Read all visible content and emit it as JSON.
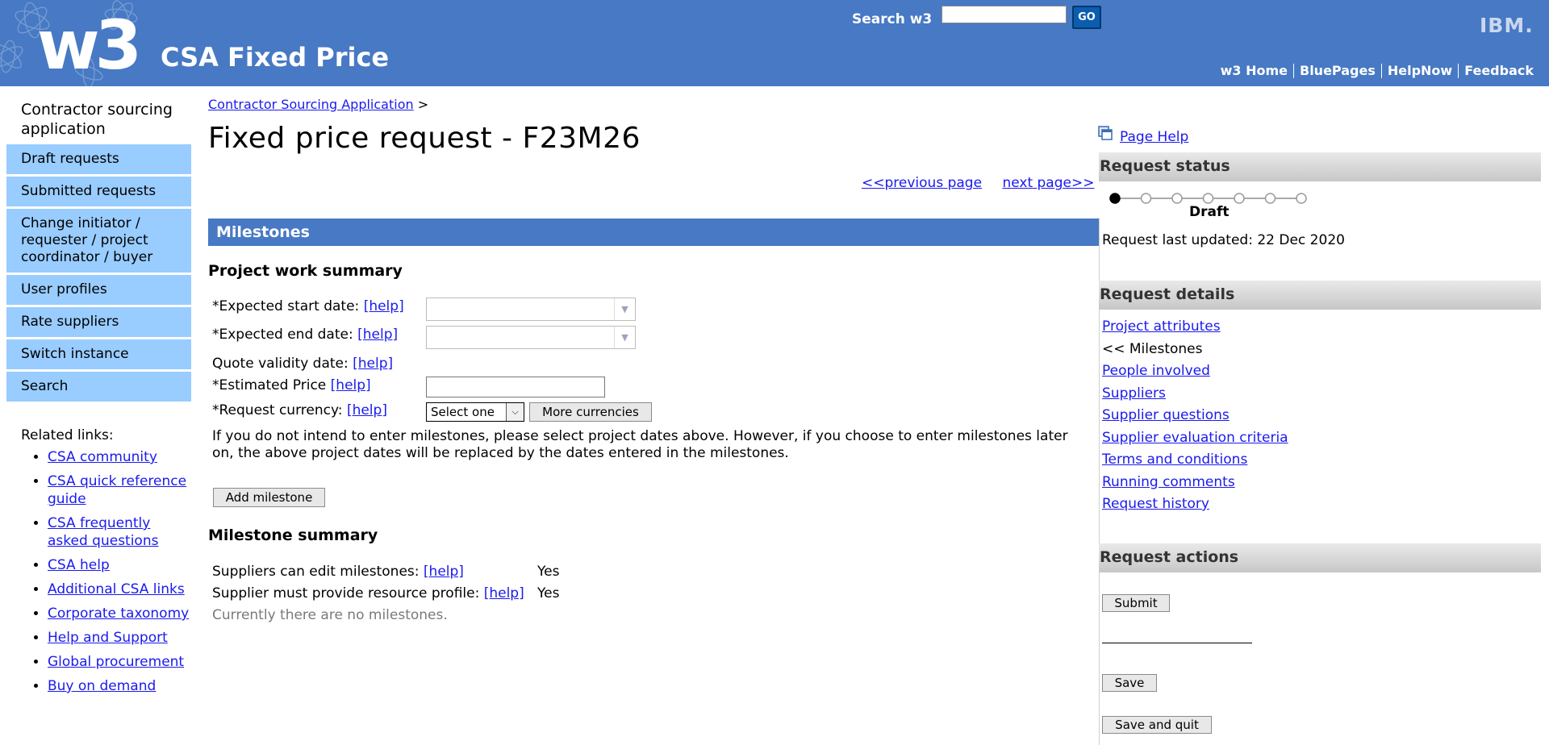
{
  "header": {
    "logo_text": "w3",
    "app_title": "CSA Fixed Price",
    "search_label": "Search w3",
    "search_value": "",
    "go_label": "GO",
    "brand": "IBM.",
    "links": [
      "w3 Home",
      "BluePages",
      "HelpNow",
      "Feedback"
    ]
  },
  "left_nav": {
    "title": "Contractor sourcing application",
    "items": [
      "Draft requests",
      "Submitted requests",
      "Change initiator / requester / project coordinator / buyer",
      "User profiles",
      "Rate suppliers",
      "Switch instance",
      "Search"
    ],
    "related_label": "Related links:",
    "related_links": [
      "CSA community",
      "CSA quick reference guide",
      "CSA frequently asked questions",
      "CSA help",
      "Additional CSA links",
      "Corporate taxonomy",
      "Help and Support",
      "Global procurement",
      "Buy on demand"
    ]
  },
  "main": {
    "breadcrumb_link": "Contractor Sourcing Application",
    "breadcrumb_sep": ">",
    "title": "Fixed price request - F23M26",
    "prev_page": "<<previous page",
    "next_page": "next page>>",
    "section_bar": "Milestones",
    "work_summary_heading": "Project work summary",
    "help_label": "[help]",
    "start_date_label": "*Expected start date:",
    "end_date_label": "*Expected end date:",
    "quote_validity_label": "Quote validity date:",
    "estimated_price_label": "*Estimated Price",
    "currency_label": "*Request currency:",
    "currency_value": "Select one",
    "more_currencies": "More currencies",
    "info_text": "If you do not intend to enter milestones, please select project dates above. However, if you choose to enter milestones later on, the above project dates will be replaced by the dates entered in the milestones.",
    "add_milestone": "Add milestone",
    "milestone_summary_heading": "Milestone summary",
    "suppliers_edit_label": "Suppliers can edit milestones:",
    "suppliers_edit_value": "Yes",
    "resource_profile_label": "Supplier must provide resource profile:",
    "resource_profile_value": "Yes",
    "no_milestones": "Currently there are no milestones."
  },
  "right_panel": {
    "page_help": "Page Help",
    "status_heading": "Request status",
    "status_value": "Draft",
    "status_steps": 7,
    "status_current_step": 1,
    "last_updated": "Request last updated: 22 Dec 2020",
    "details_heading": "Request details",
    "details_items": [
      "Project attributes",
      "<< Milestones",
      "People involved",
      "Suppliers",
      "Supplier questions",
      "Supplier evaluation criteria",
      "Terms and conditions",
      "Running comments",
      "Request history"
    ],
    "actions_heading": "Request actions",
    "submit": "Submit",
    "save": "Save",
    "save_and_quit": "Save and quit"
  },
  "colors": {
    "header_bg": "#4779c4",
    "nav_item_bg": "#99ccff",
    "link": "#1a1aee",
    "go_button": "#0b5db0"
  }
}
